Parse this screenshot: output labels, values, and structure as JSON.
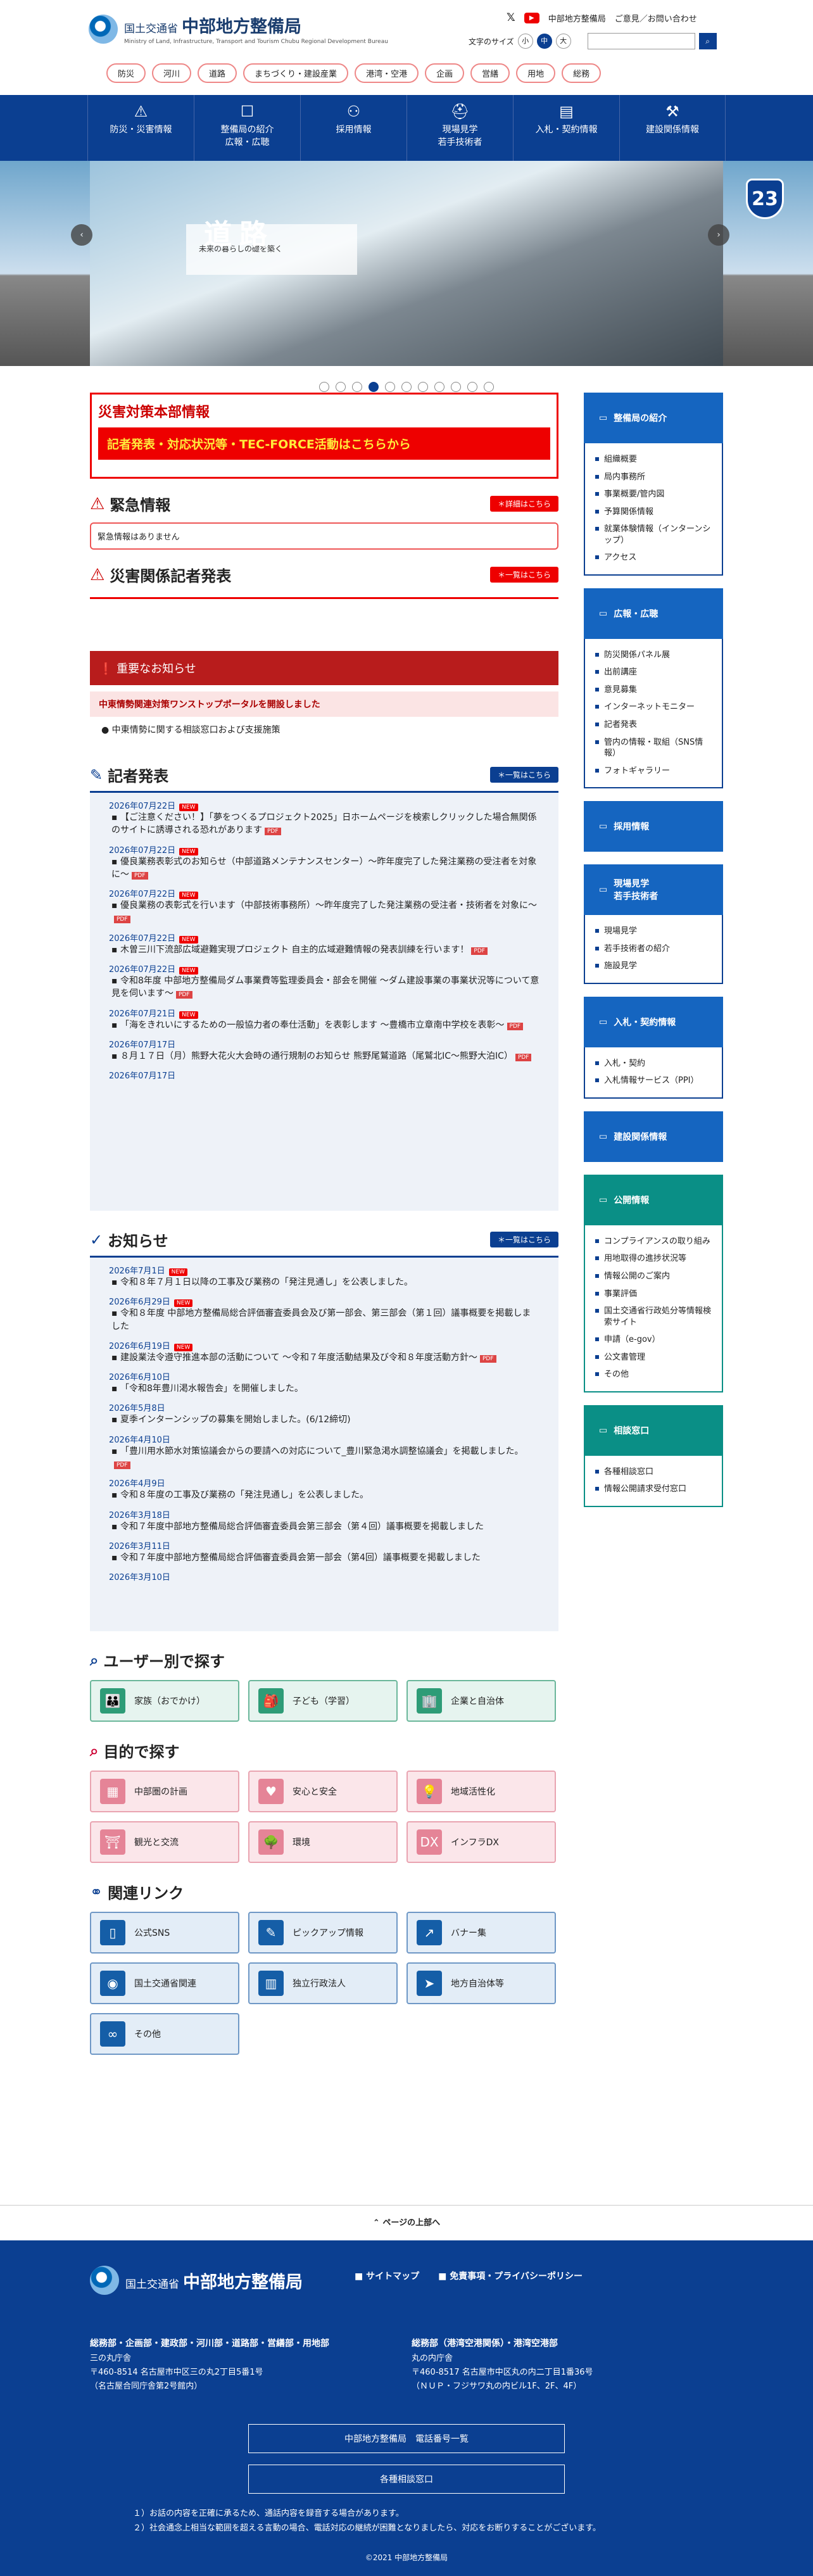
{
  "header": {
    "agency": "国土交通省",
    "bureau": "中部地方整備局",
    "sub": "Ministry of Land, Infrastructure, Transport and Tourism Chubu Regional Development Bureau",
    "x_label": "𝕏",
    "yt_label": "▶",
    "tweet_label": "中部地方整備局",
    "opinion": "ご意見／お問い合わせ",
    "font_size": "文字のサイズ",
    "sizes": [
      "小",
      "中",
      "大"
    ],
    "search_icon": "search-icon"
  },
  "categories": [
    "防災",
    "河川",
    "道路",
    "まちづくり・建設産業",
    "港湾・空港",
    "企画",
    "営繕",
    "用地",
    "総務"
  ],
  "gnav": [
    {
      "icon": "⚠",
      "label": "防災・災害情報"
    },
    {
      "icon": "☐",
      "label": "整備局の紹介\n広報・広聴"
    },
    {
      "icon": "⚇",
      "label": "採用情報"
    },
    {
      "icon": "⛑",
      "label": "現場見学\n若手技術者"
    },
    {
      "icon": "▤",
      "label": "入札・契約情報"
    },
    {
      "icon": "⚒",
      "label": "建設関係情報"
    }
  ],
  "hero": {
    "sub": "未来の暮らしの礎を築く",
    "title": "道路",
    "sign": "23",
    "arrow_l": "‹",
    "arrow_r": "›"
  },
  "disaster": {
    "title": "災害対策本部情報",
    "link": "記者発表・対応状況等・TEC-FORCE活動はこちらから"
  },
  "emergency": {
    "title": "緊急情報",
    "more": "＊詳細はこちら",
    "none": "緊急情報はありません"
  },
  "disaster_press": {
    "title": "災害関係記者発表",
    "more": "＊一覧はこちら"
  },
  "important": {
    "title": "重要なお知らせ",
    "link": "中東情勢関連対策ワンストップポータルを開設しました",
    "item": "中東情勢に関する相談窓口および支援施策"
  },
  "press": {
    "title": "記者発表",
    "more": "＊一覧はこちら",
    "items": [
      {
        "date": "2026年07月22日",
        "new": "NEW",
        "text": "【ご注意ください！】「夢をつくるプロジェクト2025」日ホームページを検索しクリックした場合無関係のサイトに誘導される恐れがあります",
        "pdf": "PDF"
      },
      {
        "date": "2026年07月22日",
        "new": "NEW",
        "text": "優良業務表彰式のお知らせ（中部道路メンテナンスセンター）～昨年度完了した発注業務の受注者を対象に～",
        "pdf": "PDF"
      },
      {
        "date": "2026年07月22日",
        "new": "NEW",
        "text": "優良業務の表彰式を行います（中部技術事務所）～昨年度完了した発注業務の受注者・技術者を対象に～",
        "pdf": "PDF"
      },
      {
        "date": "2026年07月22日",
        "new": "NEW",
        "text": "木曽三川下流部広域避難実現プロジェクト 自主的広域避難情報の発表訓練を行います！",
        "pdf": "PDF"
      },
      {
        "date": "2026年07月22日",
        "new": "NEW",
        "text": "令和8年度 中部地方整備局ダム事業費等監理委員会・部会を開催 ～ダム建設事業の事業状況等について意見を伺います～",
        "pdf": "PDF"
      },
      {
        "date": "2026年07月21日",
        "new": "NEW",
        "text": "「海をきれいにするための一般協力者の奉仕活動」を表彰します ～豊橋市立章南中学校を表彰～",
        "pdf": "PDF"
      },
      {
        "date": "2026年07月17日",
        "new": "",
        "text": "８月１７日（月）熊野大花火大会時の通行規制のお知らせ 熊野尾鷲道路（尾鷲北IC～熊野大泊IC）",
        "pdf": "PDF"
      },
      {
        "date": "2026年07月17日",
        "new": "",
        "text": "",
        "pdf": ""
      }
    ]
  },
  "news": {
    "title": "お知らせ",
    "more": "＊一覧はこちら",
    "items": [
      {
        "date": "2026年7月1日",
        "new": "NEW",
        "text": "令和８年７月１日以降の工事及び業務の「発注見通し」を公表しました。",
        "pdf": ""
      },
      {
        "date": "2026年6月29日",
        "new": "NEW",
        "text": "令和８年度 中部地方整備局総合評価審査委員会及び第一部会、第三部会（第１回）議事概要を掲載しました",
        "pdf": ""
      },
      {
        "date": "2026年6月19日",
        "new": "NEW",
        "text": "建設業法令遵守推進本部の活動について ～令和７年度活動結果及び令和８年度活動方針～",
        "pdf": "PDF"
      },
      {
        "date": "2026年6月10日",
        "new": "",
        "text": "「令和8年豊川渇水報告会」を開催しました。",
        "pdf": ""
      },
      {
        "date": "2026年5月8日",
        "new": "",
        "text": "夏季インターンシップの募集を開始しました。(6/12締切)",
        "pdf": ""
      },
      {
        "date": "2026年4月10日",
        "new": "",
        "text": "「豊川用水節水対策協議会からの要請への対応について_豊川緊急渇水調整協議会」を掲載しました。",
        "pdf": "PDF"
      },
      {
        "date": "2026年4月9日",
        "new": "",
        "text": "令和８年度の工事及び業務の「発注見通し」を公表しました。",
        "pdf": ""
      },
      {
        "date": "2026年3月18日",
        "new": "",
        "text": "令和７年度中部地方整備局総合評価審査委員会第三部会（第４回）議事概要を掲載しました",
        "pdf": ""
      },
      {
        "date": "2026年3月11日",
        "new": "",
        "text": "令和７年度中部地方整備局総合評価審査委員会第一部会（第4回）議事概要を掲載しました",
        "pdf": ""
      },
      {
        "date": "2026年3月10日",
        "new": "",
        "text": "",
        "pdf": ""
      }
    ]
  },
  "users": {
    "title": "ユーザー別で探す",
    "items": [
      {
        "icon": "👪",
        "label": "家族（おでかけ）"
      },
      {
        "icon": "🎒",
        "label": "子ども（学習）"
      },
      {
        "icon": "🏢",
        "label": "企業と自治体"
      }
    ]
  },
  "purpose": {
    "title": "目的で探す",
    "items": [
      {
        "icon": "▦",
        "label": "中部圏の計画"
      },
      {
        "icon": "♥",
        "label": "安心と安全"
      },
      {
        "icon": "💡",
        "label": "地域活性化"
      },
      {
        "icon": "⛩",
        "label": "観光と交流"
      },
      {
        "icon": "🌳",
        "label": "環境"
      },
      {
        "icon": "DX",
        "label": "インフラDX"
      }
    ]
  },
  "related": {
    "title": "関連リンク",
    "items": [
      {
        "icon": "▯",
        "label": "公式SNS"
      },
      {
        "icon": "✎",
        "label": "ピックアップ情報"
      },
      {
        "icon": "↗",
        "label": "バナー集"
      },
      {
        "icon": "◉",
        "label": "国土交通省関連"
      },
      {
        "icon": "▥",
        "label": "独立行政法人"
      },
      {
        "icon": "➤",
        "label": "地方自治体等"
      },
      {
        "icon": "∞",
        "label": "その他"
      }
    ]
  },
  "sidebar": [
    {
      "title": "整備局の紹介",
      "items": [
        "組織概要",
        "局内事務所",
        "事業概要/管内図",
        "予算関係情報",
        "就業体験情報（インターンシップ）",
        "アクセス"
      ]
    },
    {
      "title": "広報・広聴",
      "items": [
        "防災関係パネル展",
        "出前講座",
        "意見募集",
        "インターネットモニター",
        "記者発表",
        "管内の情報・取組（SNS情報）",
        "フォトギャラリー"
      ]
    },
    {
      "title": "採用情報",
      "items": []
    },
    {
      "title": "現場見学\n若手技術者",
      "items": [
        "現場見学",
        "若手技術者の紹介",
        "施設見学"
      ]
    },
    {
      "title": "入札・契約情報",
      "items": [
        "入札・契約",
        "入札情報サービス（PPI）"
      ]
    },
    {
      "title": "建設関係情報",
      "items": []
    },
    {
      "title": "公開情報",
      "items": [
        "コンプライアンスの取り組み",
        "用地取得の進捗状況等",
        "情報公開のご案内",
        "事業評価",
        "国土交通省行政処分等情報検索サイト",
        "申請（e-gov）",
        "公文書管理",
        "その他"
      ]
    },
    {
      "title": "相談窓口",
      "items": [
        "各種相談窓口",
        "情報公開請求受付窓口"
      ]
    }
  ],
  "totop": "ページの上部へ",
  "footer": {
    "links": [
      "サイトマップ",
      "免責事項・プライバシーポリシー"
    ],
    "addr1": {
      "title": "総務部・企画部・建政部・河川部・道路部・営繕部・用地部",
      "name": "三の丸庁舎",
      "addr": "〒460-8514 名古屋市中区三の丸2丁目5番1号",
      "note": "（名古屋合同庁舎第2号館内）"
    },
    "addr2": {
      "title": "総務部（港湾空港関係）・港湾空港部",
      "name": "丸の内庁舎",
      "addr": "〒460-8517 名古屋市中区丸の内二丁目1番36号",
      "note": "（ＮＵＰ・フジサワ丸の内ビル1F、2F、4F）"
    },
    "btn1": "中部地方整備局　電話番号一覧",
    "btn2": "各種相談窓口",
    "note1": "１）お話の内容を正確に承るため、通話内容を録音する場合があります。",
    "note2": "２）社会通念上相当な範囲を超える言動の場合、電話対応の継続が困難となりましたら、対応をお断りすることがございます。",
    "copy": "©2021 中部地方整備局"
  }
}
